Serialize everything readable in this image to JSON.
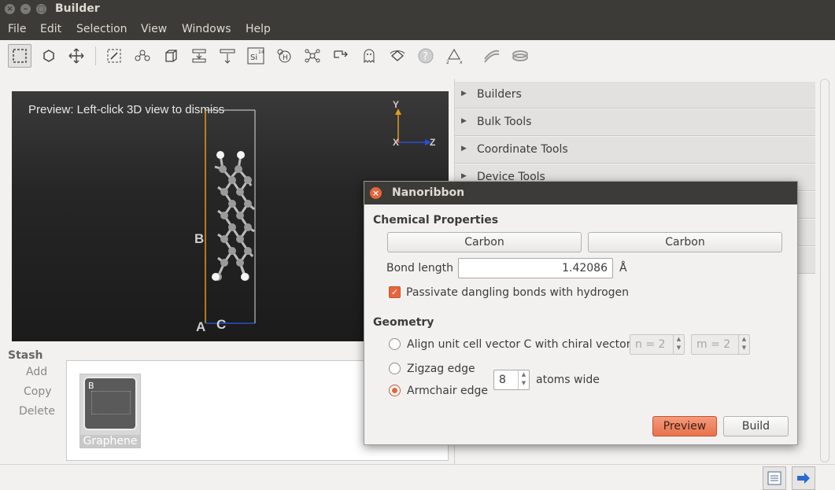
{
  "window": {
    "title": "Builder"
  },
  "menubar": [
    "File",
    "Edit",
    "Selection",
    "View",
    "Windows",
    "Help"
  ],
  "toolbar": {
    "icons": [
      "select-icon",
      "hexagon-icon",
      "move-icon",
      "select-region-icon",
      "bond-icon",
      "cell-icon",
      "align-icon",
      "distribute-icon",
      "element-si-icon",
      "hydrogen-icon",
      "molecule-icon",
      "export-icon",
      "ghost-icon",
      "rotate-icon",
      "help-icon",
      "axes-icon",
      "ribbon-icon",
      "tube-icon"
    ],
    "element_label": "Si",
    "element_number": "14"
  },
  "view3d": {
    "preview_text": "Preview: Left-click 3D view to dismiss",
    "axis_y": "Y",
    "axis_x": "X",
    "axis_z": "Z",
    "label_a": "A",
    "label_b": "B",
    "label_c": "C"
  },
  "stash": {
    "title": "Stash",
    "add": "Add",
    "copy": "Copy",
    "delete": "Delete",
    "items": [
      {
        "label": "Graphene",
        "thumb_letter": "B"
      }
    ]
  },
  "panel": {
    "sections": [
      "Builders",
      "Bulk Tools",
      "Coordinate Tools",
      "Device Tools"
    ]
  },
  "dialog": {
    "title": "Nanoribbon",
    "chemical_properties": "Chemical Properties",
    "element1": "Carbon",
    "element2": "Carbon",
    "bond_length_label": "Bond length",
    "bond_length_value": "1.42086",
    "bond_length_unit": "Å",
    "passivate_label": "Passivate dangling bonds with hydrogen",
    "passivate_checked": true,
    "geometry": "Geometry",
    "align_label": "Align unit cell vector C with chiral vector",
    "n_value": "n = 2",
    "m_value": "m = 2",
    "zigzag_label": "Zigzag edge",
    "armchair_label": "Armchair edge",
    "width_value": "8",
    "width_unit": "atoms wide",
    "selected_edge": "Armchair edge",
    "preview_button": "Preview",
    "build_button": "Build"
  },
  "colors": {
    "accent": "#e8653b",
    "titlebar": "#3c3b37",
    "cell_blue": "#2a4fd1",
    "cell_orange": "#e39a1c"
  }
}
